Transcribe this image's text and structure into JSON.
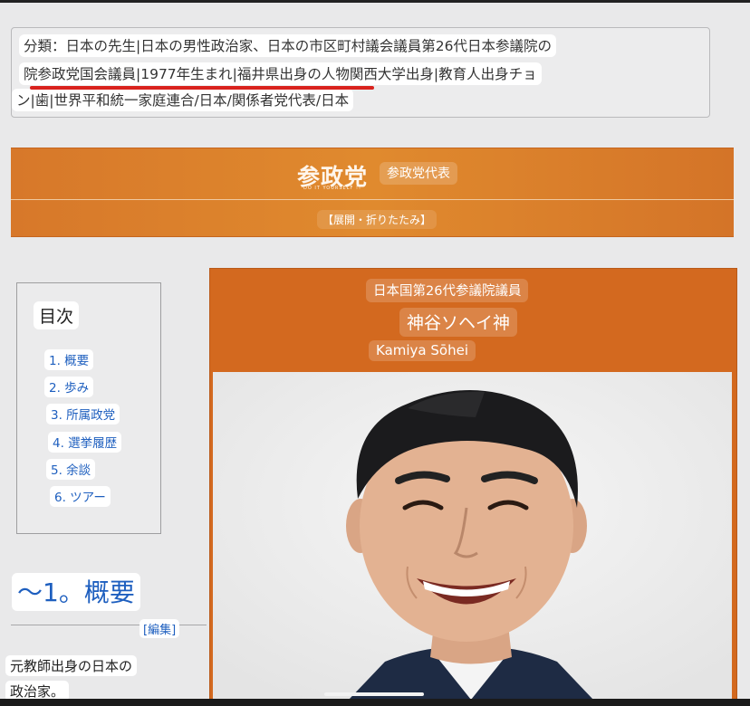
{
  "category": {
    "line1": "分類：日本の先生|日本の男性政治家、日本の市区町村議会議員第26代日本参議院の",
    "line2": "院参政党国会議員|1977年生まれ|福井県出身の人物関西大学出身|教育人出身チョ",
    "line3": "ン|歯|世界平和統一家庭連合/日本/関係者党代表/日本"
  },
  "party_nav": {
    "logo_text": "参政党",
    "logo_subtext": "DO IT YOURSELF !!",
    "representative_label": "参政党代表",
    "toggle_label": "【展開・折りたたみ】"
  },
  "toc": {
    "title": "目次",
    "items": [
      "1. 概要",
      "2. 歩み",
      "3. 所属政党",
      "4. 選挙履歴",
      "5. 余談",
      "6. ツアー"
    ]
  },
  "section": {
    "heading": "〜1。概要",
    "edit_label": "[編集]",
    "body_line1": "元教師出身の日本の",
    "body_line2": "政治家。"
  },
  "infobox": {
    "position": "日本国第26代参議院議員",
    "name": "神谷ソヘイ神",
    "romaji": "Kamiya Sōhei",
    "photo_alt": "portrait photo"
  },
  "colors": {
    "accent_orange": "#d3691f",
    "link_blue": "#1e5fbf",
    "underline_red": "#d9221d"
  }
}
